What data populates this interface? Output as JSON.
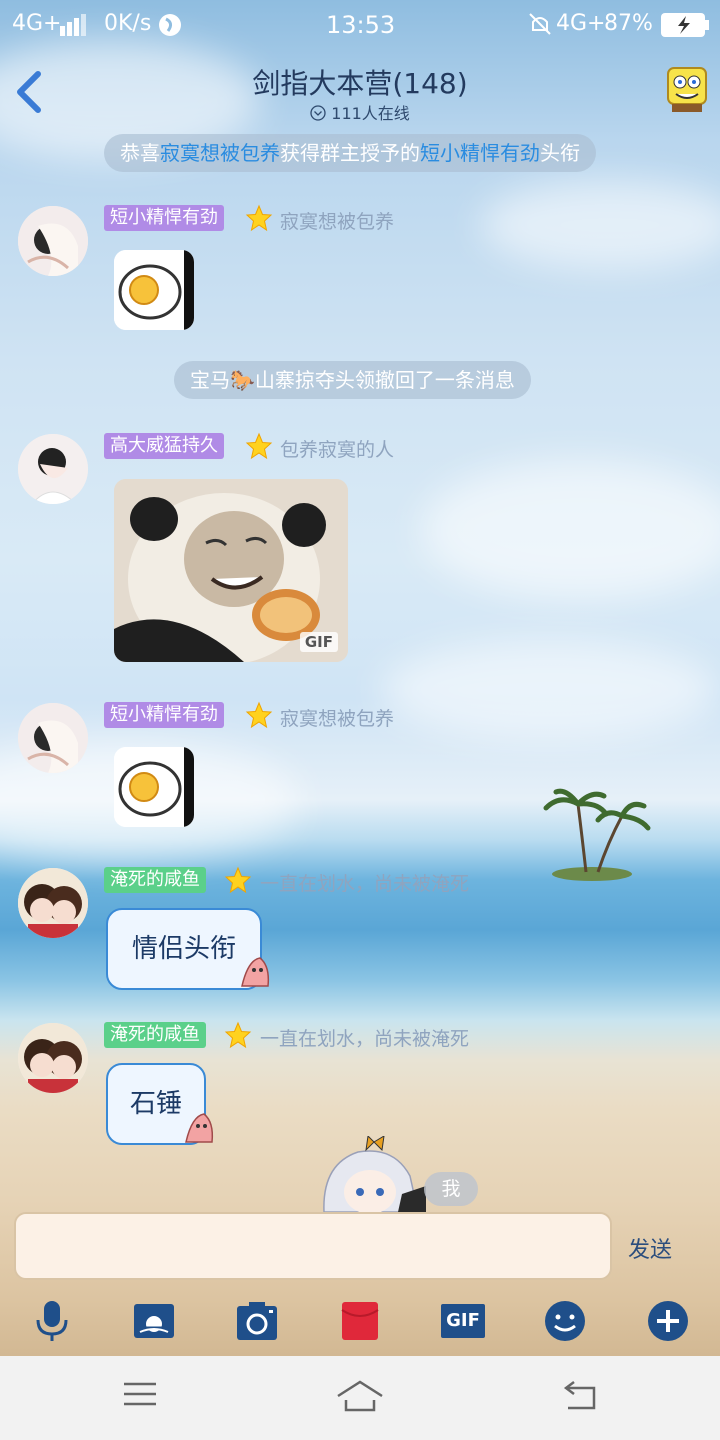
{
  "status": {
    "network": "4G+",
    "speed": "0K/s",
    "time": "13:53",
    "network2": "4G+",
    "battery": "87%"
  },
  "header": {
    "title": "剑指大本营(148)",
    "online": "111人在线"
  },
  "system_messages": {
    "award": {
      "prefix": "恭喜",
      "user": "寂寞想被包养",
      "middle": "获得群主授予的",
      "title": "短小精悍有劲",
      "suffix": "头衔"
    },
    "recall": {
      "prefix": "宝马",
      "suffix": "山寨掠夺头领撤回了一条消息"
    }
  },
  "messages": [
    {
      "tag": "短小精悍有劲",
      "nickname": "寂寞想被包养",
      "content_type": "sticker-egg"
    },
    {
      "tag": "高大威猛持久",
      "nickname": "包养寂寞的人",
      "content_type": "sticker-panda",
      "badge": "GIF"
    },
    {
      "tag": "短小精悍有劲",
      "nickname": "寂寞想被包养",
      "content_type": "sticker-egg"
    },
    {
      "tag": "淹死的咸鱼",
      "nickname": "一直在划水，尚未被淹死",
      "text": "情侣头衔"
    },
    {
      "tag": "淹死的咸鱼",
      "nickname": "一直在划水，尚未被淹死",
      "text": "石锤"
    }
  ],
  "me_label": "我",
  "composer": {
    "value": "",
    "send_label": "发送",
    "gif_label": "GIF"
  },
  "toolbar_icons": [
    "microphone-icon",
    "image-icon",
    "camera-icon",
    "red-packet-icon",
    "gif-icon",
    "emoji-icon",
    "plus-icon"
  ],
  "colors": {
    "accent": "#2a8ce0",
    "tag_purple": "#b08be6",
    "tag_green": "#5bd08a",
    "bubble_border": "#3a8ad6"
  }
}
